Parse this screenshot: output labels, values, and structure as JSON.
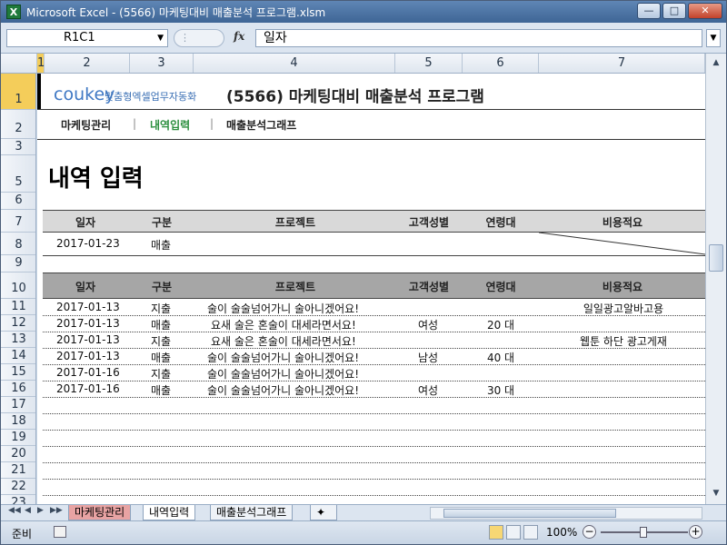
{
  "window": {
    "title": "Microsoft Excel - (5566) 마케팅대비 매출분석 프로그램.xlsm",
    "app_icon": "X"
  },
  "formula_bar": {
    "name_box": "R1C1",
    "content": "일자"
  },
  "columns": [
    "1",
    "2",
    "3",
    "4",
    "5",
    "6",
    "7"
  ],
  "rows": [
    "1",
    "2",
    "3",
    "5",
    "6",
    "7",
    "8",
    "9",
    "10",
    "11",
    "12",
    "13",
    "14",
    "15",
    "16",
    "17",
    "18",
    "19",
    "20",
    "21",
    "22",
    "23"
  ],
  "header": {
    "logo_main": "coukey",
    "logo_sub": "맞춤형엑셀업무자동화",
    "program_title": "(5566) 마케팅대비 매출분석 프로그램",
    "nav": [
      "마케팅관리",
      "내역입력",
      "매출분석그래프"
    ],
    "nav_separator": "|",
    "page_heading": "내역 입력"
  },
  "input_table": {
    "headers": [
      "일자",
      "구분",
      "프로젝트",
      "고객성별",
      "연령대",
      "비용적요"
    ],
    "row": [
      "2017-01-23",
      "매출",
      "",
      "",
      "",
      ""
    ]
  },
  "data_table": {
    "headers": [
      "일자",
      "구분",
      "프로젝트",
      "고객성별",
      "연령대",
      "비용적요"
    ],
    "rows": [
      [
        "2017-01-13",
        "지출",
        "술이 술술넘어가니 술아니겠어요!",
        "",
        "",
        "일일광고알바고용"
      ],
      [
        "2017-01-13",
        "매출",
        "요새 술은 혼술이 대세라면서요!",
        "여성",
        "20 대",
        ""
      ],
      [
        "2017-01-13",
        "지출",
        "요새 술은 혼술이 대세라면서요!",
        "",
        "",
        "웹툰 하단 광고게재"
      ],
      [
        "2017-01-13",
        "매출",
        "술이 술술넘어가니 술아니겠어요!",
        "남성",
        "40 대",
        ""
      ],
      [
        "2017-01-16",
        "지출",
        "술이 술술넘어가니 술아니겠어요!",
        "",
        "",
        ""
      ],
      [
        "2017-01-16",
        "매출",
        "술이 술술넘어가니 술아니겠어요!",
        "여성",
        "30 대",
        ""
      ]
    ]
  },
  "tabs": [
    "마케팅관리",
    "내역입력",
    "매출분석그래프"
  ],
  "status": {
    "ready": "준비",
    "zoom": "100%"
  },
  "colors": {
    "accent_green": "#2c8f3f",
    "selected_header": "#f4cd5a",
    "tab_red": "#e8a3a3"
  }
}
